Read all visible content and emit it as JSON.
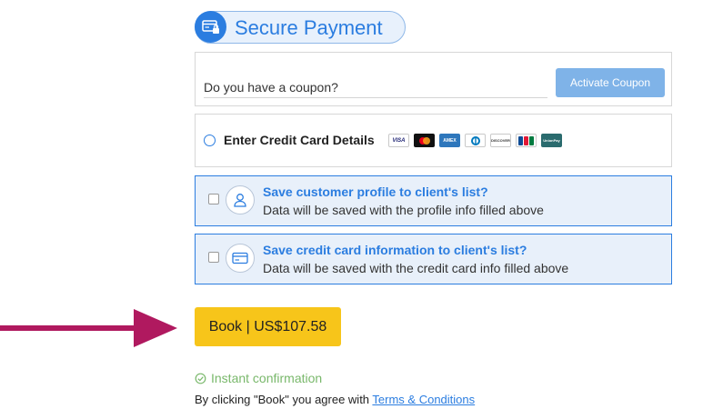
{
  "header": {
    "title": "Secure Payment",
    "icon": "payment-card-lock-icon"
  },
  "coupon": {
    "placeholder": "Do you have a coupon?",
    "button_label": "Activate Coupon"
  },
  "payment": {
    "option_label": "Enter Credit Card Details",
    "card_logos": [
      "VISA",
      "MC",
      "AMEX",
      "DC",
      "DISCOVER",
      "JCB",
      "UnionPay"
    ]
  },
  "save_options": [
    {
      "title": "Save customer profile to client's list?",
      "description": "Data will be saved with the profile info filled above",
      "icon": "user-profile-icon"
    },
    {
      "title": "Save credit card information to client's list?",
      "description": "Data will be saved with the credit card info filled above",
      "icon": "credit-card-icon"
    }
  ],
  "book": {
    "label": "Book | US$107.58"
  },
  "confirmation": {
    "text": "Instant confirmation"
  },
  "agreement": {
    "prefix": "By clicking \"Book\" you agree with ",
    "link": "Terms & Conditions"
  },
  "colors": {
    "accent": "#2b7de0",
    "book": "#f7c51a",
    "arrow": "#b0195f",
    "confirm": "#79b86b"
  }
}
